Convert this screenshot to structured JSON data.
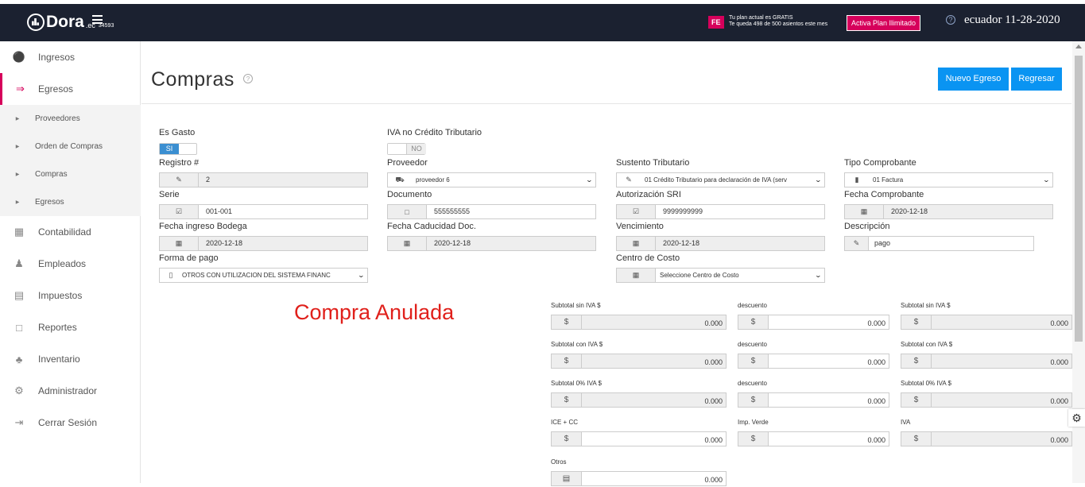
{
  "topbar": {
    "brand": "Dora",
    "brand_suffix": ".ec",
    "company_code": "34593",
    "fe_badge": "FE",
    "plan_line1": "Tu plan actual es GRATIS",
    "plan_line2": "Te queda 498 de 500 asientos este mes",
    "activate_button": "Activa Plan Ilimitado",
    "help_icon": "?",
    "user_label": "ecuador 11-28-2020"
  },
  "sidebar": {
    "items": [
      {
        "label": "Ingresos",
        "icon": "money-bag-icon"
      },
      {
        "label": "Egresos",
        "icon": "transfer-icon"
      },
      {
        "label": "Contabilidad",
        "icon": "calculator-icon"
      },
      {
        "label": "Empleados",
        "icon": "people-icon"
      },
      {
        "label": "Impuestos",
        "icon": "tax-icon"
      },
      {
        "label": "Reportes",
        "icon": "report-icon"
      },
      {
        "label": "Inventario",
        "icon": "boxes-icon"
      },
      {
        "label": "Administrador",
        "icon": "gear-icon"
      },
      {
        "label": "Cerrar Sesión",
        "icon": "logout-icon"
      }
    ],
    "subitems": [
      "Proveedores",
      "Orden de Compras",
      "Compras",
      "Egresos"
    ]
  },
  "page": {
    "title": "Compras",
    "new_button": "Nuevo Egreso",
    "back_button": "Regresar",
    "anulada": "Compra Anulada"
  },
  "form": {
    "es_gasto_label": "Es Gasto",
    "es_gasto_value": "SI",
    "iva_label": "IVA no Crédito Tributario",
    "iva_value": "NO",
    "registro_label": "Registro #",
    "registro_value": "2",
    "proveedor_label": "Proveedor",
    "proveedor_value": "proveedor 6",
    "sustento_label": "Sustento Tributario",
    "sustento_value": "01 Crédito Tributario para declaración de IVA (serv",
    "tipo_label": "Tipo Comprobante",
    "tipo_value": "01 Factura",
    "serie_label": "Serie",
    "serie_value": "001-001",
    "documento_label": "Documento",
    "documento_value": "555555555",
    "autorizacion_label": "Autorización SRI",
    "autorizacion_value": "9999999999",
    "fecha_comp_label": "Fecha Comprobante",
    "fecha_comp_value": "2020-12-18",
    "fecha_bodega_label": "Fecha ingreso Bodega",
    "fecha_bodega_value": "2020-12-18",
    "fecha_cad_label": "Fecha Caducidad Doc.",
    "fecha_cad_value": "2020-12-18",
    "vencimiento_label": "Vencimiento",
    "vencimiento_value": "2020-12-18",
    "descripcion_label": "Descripción",
    "descripcion_value": "pago",
    "forma_pago_label": "Forma de pago",
    "forma_pago_value": "OTROS CON UTILIZACION DEL SISTEMA FINANC",
    "centro_label": "Centro de Costo",
    "centro_value": "Seleccione Centro de Costo"
  },
  "totals": {
    "currency": "$",
    "rows": [
      [
        {
          "label": "Subtotal sin IVA $",
          "value": "0.000"
        },
        {
          "label": "descuento",
          "value": "0.000"
        },
        {
          "label": "Subtotal sin IVA $",
          "value": "0.000"
        }
      ],
      [
        {
          "label": "Subtotal con IVA $",
          "value": "0.000"
        },
        {
          "label": "descuento",
          "value": "0.000"
        },
        {
          "label": "Subtotal con IVA $",
          "value": "0.000"
        }
      ],
      [
        {
          "label": "Subtotal 0% IVA $",
          "value": "0.000"
        },
        {
          "label": "descuento",
          "value": "0.000"
        },
        {
          "label": "Subtotal 0% IVA $",
          "value": "0.000"
        }
      ],
      [
        {
          "label": "ICE + CC",
          "value": "0.000"
        },
        {
          "label": "Imp. Verde",
          "value": "0.000"
        },
        {
          "label": "IVA",
          "value": "0.000"
        }
      ]
    ],
    "otros_label": "Otros",
    "otros_value": "0.000"
  }
}
